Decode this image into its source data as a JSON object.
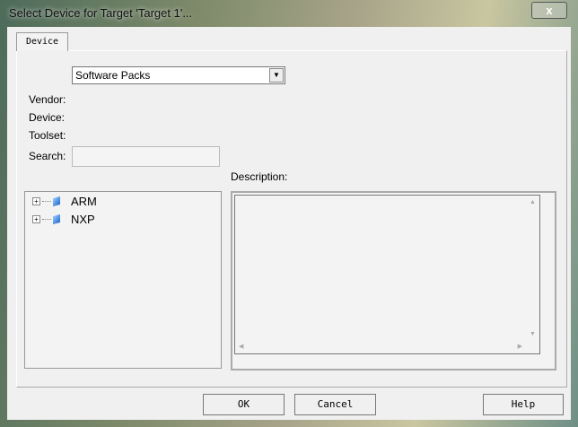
{
  "window": {
    "title": "Select Device for Target 'Target 1'...",
    "close": "x"
  },
  "tabs": [
    {
      "label": "Device"
    }
  ],
  "source_select": {
    "value": "Software Packs"
  },
  "fields": {
    "vendor": "Vendor:",
    "device": "Device:",
    "toolset": "Toolset:",
    "search": "Search:",
    "search_value": ""
  },
  "tree": [
    {
      "label": "ARM"
    },
    {
      "label": "NXP"
    }
  ],
  "description": {
    "label": "Description:"
  },
  "buttons": {
    "ok": "OK",
    "cancel": "Cancel",
    "help": "Help"
  }
}
